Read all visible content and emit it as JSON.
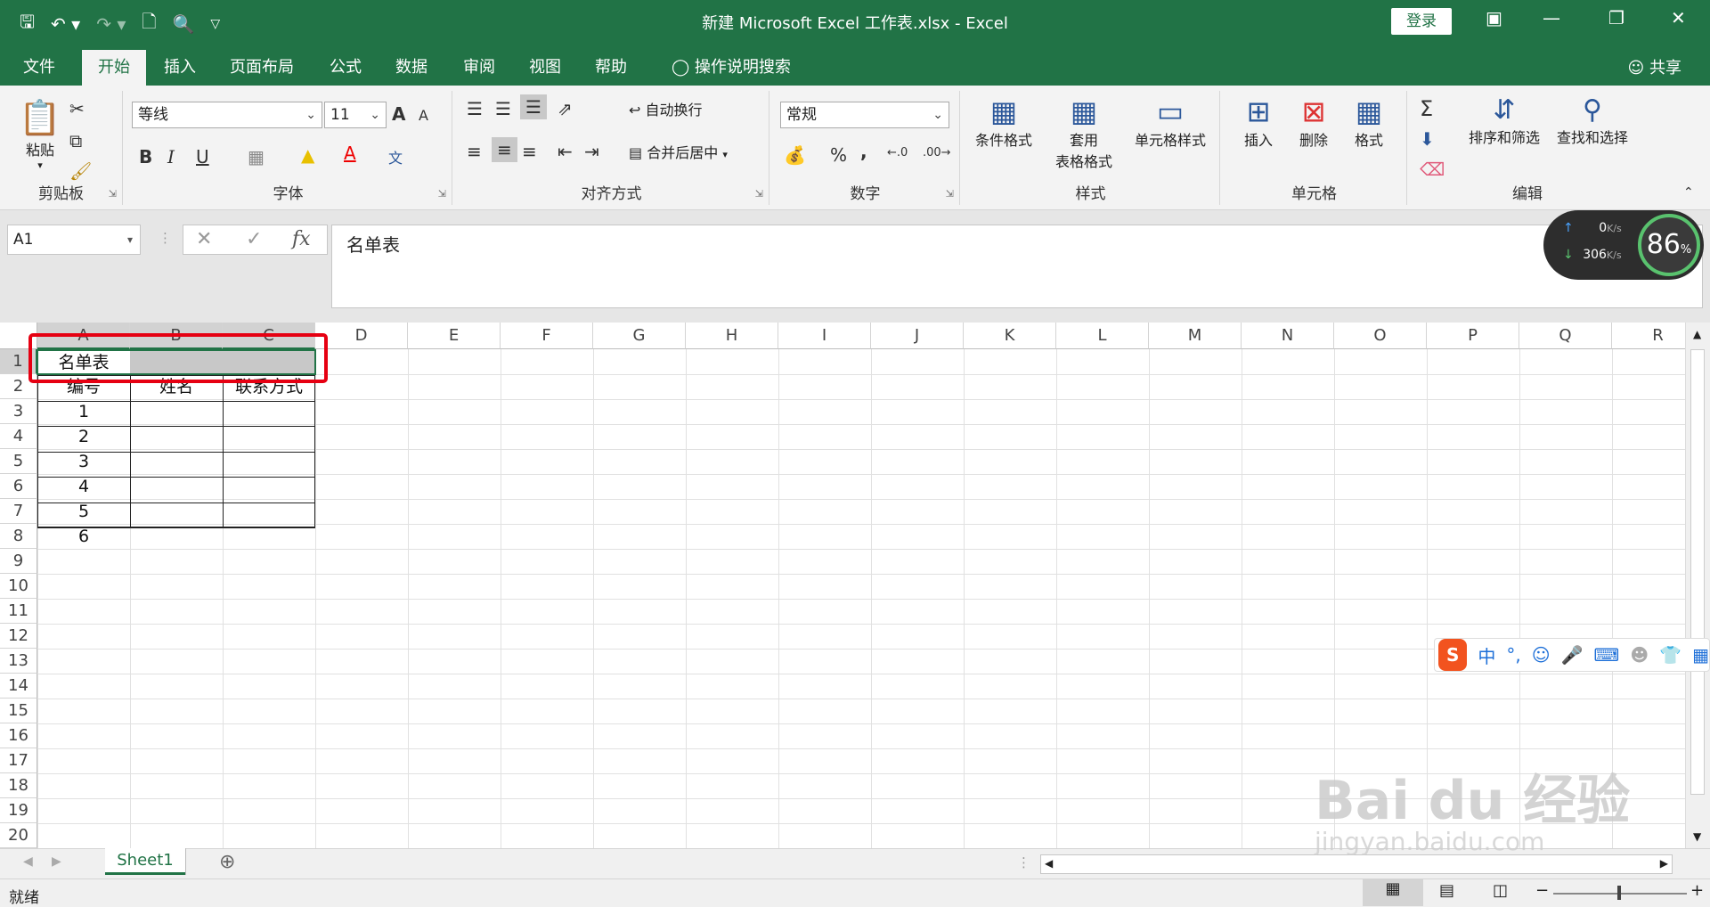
{
  "app": {
    "title": "新建 Microsoft Excel 工作表.xlsx  -  Excel",
    "login": "登录",
    "share": "共享"
  },
  "tabs": [
    "文件",
    "开始",
    "插入",
    "页面布局",
    "公式",
    "数据",
    "审阅",
    "视图",
    "帮助"
  ],
  "tell_me": "操作说明搜索",
  "ribbon": {
    "clipboard": {
      "label": "剪贴板",
      "paste": "粘贴"
    },
    "font": {
      "label": "字体",
      "name": "等线",
      "size": "11",
      "bold": "B",
      "italic": "I",
      "underline": "U",
      "grow": "A",
      "shrink": "A"
    },
    "alignment": {
      "label": "对齐方式",
      "wrap": "自动换行",
      "merge": "合并后居中"
    },
    "number": {
      "label": "数字",
      "format": "常规",
      "percent": "%",
      "comma": ","
    },
    "styles": {
      "label": "样式",
      "conditional": "条件格式",
      "table_fmt_1": "套用",
      "table_fmt_2": "表格格式",
      "cell_styles": "单元格样式"
    },
    "cells": {
      "label": "单元格",
      "insert": "插入",
      "delete": "删除",
      "format": "格式"
    },
    "editing": {
      "label": "编辑",
      "sort_filter": "排序和筛选",
      "find_select": "查找和选择"
    }
  },
  "formula_bar": {
    "name_box": "A1",
    "fx": "fx",
    "content": "名单表"
  },
  "columns": [
    "A",
    "B",
    "C",
    "D",
    "E",
    "F",
    "G",
    "H",
    "I",
    "J",
    "K",
    "L",
    "M",
    "N",
    "O",
    "P",
    "Q",
    "R"
  ],
  "rows": [
    "1",
    "2",
    "3",
    "4",
    "5",
    "6",
    "7",
    "8",
    "9",
    "10",
    "11",
    "12",
    "13",
    "14",
    "15",
    "16",
    "17",
    "18",
    "19",
    "20"
  ],
  "cells": {
    "a1": "名单表",
    "headers": [
      "编号",
      "姓名",
      "联系方式"
    ],
    "ids": [
      "1",
      "2",
      "3",
      "4",
      "5",
      "6"
    ]
  },
  "sheet": {
    "tab": "Sheet1"
  },
  "status": {
    "ready": "就绪"
  },
  "overlays": {
    "speed_up": "0",
    "speed_up_unit": "K/s",
    "speed_down": "306",
    "speed_down_unit": "K/s",
    "percent": "86",
    "percent_unit": "%",
    "ime_mode": "中",
    "watermark": "Bai du 经验",
    "watermark_url": "jingyan.baidu.com"
  },
  "colors": {
    "accent": "#217346",
    "highlight_box": "#e60012"
  }
}
